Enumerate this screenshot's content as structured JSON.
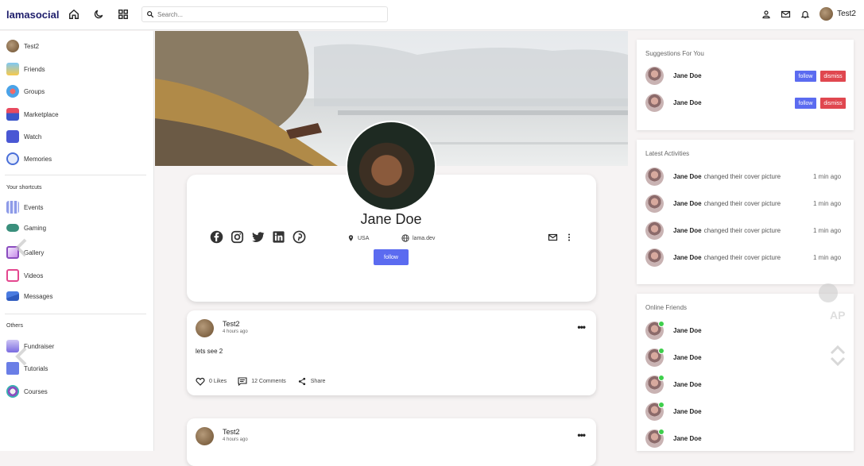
{
  "app": {
    "logo": "lamasocial"
  },
  "search": {
    "placeholder": "Search..."
  },
  "topbar": {
    "user_name": "Test2"
  },
  "sidebar": {
    "user": "Test2",
    "items": [
      "Friends",
      "Groups",
      "Marketplace",
      "Watch",
      "Memories"
    ],
    "shortcuts_heading": "Your shortcuts",
    "shortcuts": [
      "Events",
      "Gaming",
      "Gallery",
      "Videos",
      "Messages"
    ],
    "others_heading": "Others",
    "others": [
      "Fundraiser",
      "Tutorials",
      "Courses"
    ]
  },
  "profile": {
    "name": "Jane Doe",
    "location": "USA",
    "website": "lama.dev",
    "follow_label": "follow"
  },
  "posts": [
    {
      "author": "Test2",
      "time": "4 hours ago",
      "text": "lets see 2",
      "likes": "0 Likes",
      "comments": "12 Comments",
      "share": "Share"
    },
    {
      "author": "Test2",
      "time": "4 hours ago"
    }
  ],
  "suggestions": {
    "title": "Suggestions For You",
    "items": [
      {
        "name": "Jane Doe",
        "follow": "follow",
        "dismiss": "dismiss"
      },
      {
        "name": "Jane Doe",
        "follow": "follow",
        "dismiss": "dismiss"
      }
    ]
  },
  "activities": {
    "title": "Latest Activities",
    "items": [
      {
        "name": "Jane Doe",
        "action": "changed their cover picture",
        "time": "1 min ago"
      },
      {
        "name": "Jane Doe",
        "action": "changed their cover picture",
        "time": "1 min ago"
      },
      {
        "name": "Jane Doe",
        "action": "changed their cover picture",
        "time": "1 min ago"
      },
      {
        "name": "Jane Doe",
        "action": "changed their cover picture",
        "time": "1 min ago"
      }
    ]
  },
  "online": {
    "title": "Online Friends",
    "items": [
      "Jane Doe",
      "Jane Doe",
      "Jane Doe",
      "Jane Doe",
      "Jane Doe"
    ]
  },
  "overlay": {
    "text": "AP"
  },
  "colors": {
    "accent": "#5b6bf0",
    "danger": "#e0474f",
    "online": "#3ecf4c",
    "logo": "#1d1d6b"
  }
}
